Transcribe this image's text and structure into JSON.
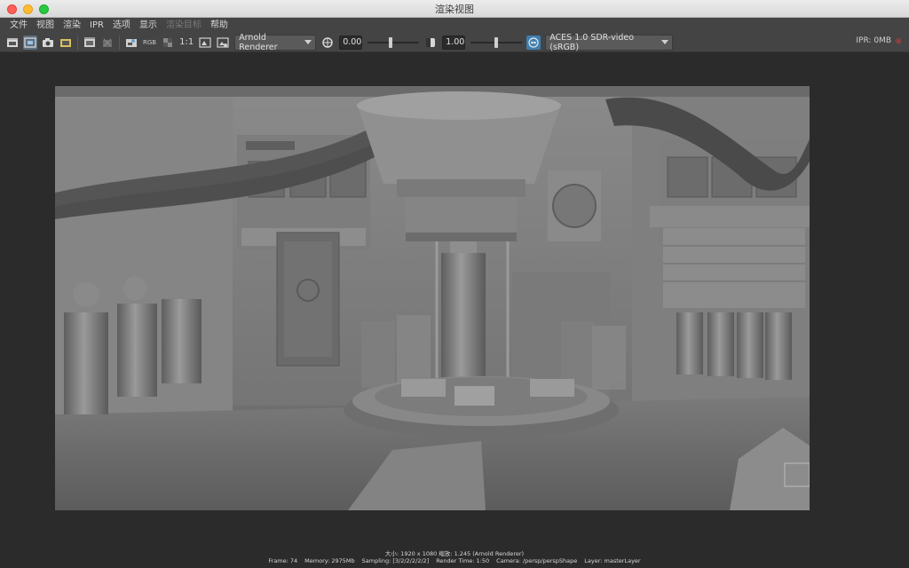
{
  "window": {
    "title": "渲染视图"
  },
  "menu": {
    "items": [
      "文件",
      "视图",
      "渲染",
      "IPR",
      "选项",
      "显示",
      "渲染目标",
      "帮助"
    ],
    "disabled_index": 6
  },
  "toolbar": {
    "rgb_label": "RGB",
    "one_to_one_label": "1:1",
    "renderer": "Arnold Renderer",
    "exposure_value": "0.00",
    "exposure_fraction": 0.45,
    "gamma_value": "1.00",
    "gamma_fraction": 0.5,
    "view_transform": "ACES 1.0 SDR-video (sRGB)",
    "ipr_memory": "IPR: 0MB"
  },
  "status": {
    "line1": "大小: 1920 x 1080  缩放: 1.245      (Arnold Renderer)",
    "frame": "Frame: 74",
    "memory": "Memory: 2975Mb",
    "sampling": "Sampling: [3/2/2/2/2/2]",
    "render_time": "Render Time: 1:50",
    "camera": "Camera: /persp/perspShape",
    "layer": "Layer: masterLayer"
  },
  "colors": {
    "accent": "#5d8fb8",
    "background": "#2b2b2b",
    "toolbar": "#444444"
  }
}
